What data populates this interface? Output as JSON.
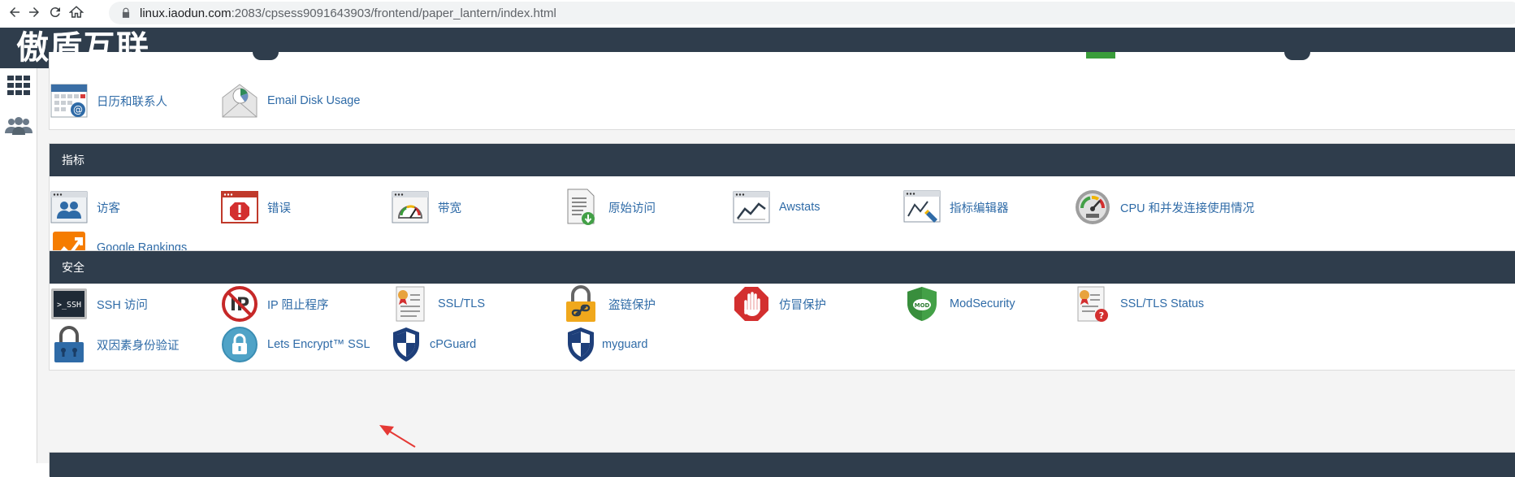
{
  "browser": {
    "url_host": "linux.iaodun.com",
    "url_rest": ":2083/cpsess9091643903/frontend/paper_lantern/index.html"
  },
  "header": {
    "brand": "傲盾互联"
  },
  "email_section": {
    "items": [
      {
        "label": "日历和联系人",
        "icon": "calendar-contacts-icon"
      },
      {
        "label": "Email Disk Usage",
        "icon": "email-disk-usage-icon"
      }
    ]
  },
  "metrics": {
    "title": "指标",
    "items": [
      {
        "label": "访客",
        "icon": "visitors-icon"
      },
      {
        "label": "错误",
        "icon": "errors-icon"
      },
      {
        "label": "带宽",
        "icon": "bandwidth-icon"
      },
      {
        "label": "原始访问",
        "icon": "raw-access-icon"
      },
      {
        "label": "Awstats",
        "icon": "awstats-icon"
      },
      {
        "label": "指标编辑器",
        "icon": "metrics-editor-icon"
      },
      {
        "label": "CPU 和并发连接使用情况",
        "icon": "cpu-usage-icon"
      },
      {
        "label": "Google Rankings",
        "icon": "google-rankings-icon"
      }
    ]
  },
  "security": {
    "title": "安全",
    "items": [
      {
        "label": "SSH 访问",
        "icon": "ssh-icon"
      },
      {
        "label": "IP 阻止程序",
        "icon": "ip-blocker-icon"
      },
      {
        "label": "SSL/TLS",
        "icon": "ssl-tls-icon"
      },
      {
        "label": "盗链保护",
        "icon": "hotlink-protection-icon"
      },
      {
        "label": "仿冒保护",
        "icon": "leech-protection-icon"
      },
      {
        "label": "ModSecurity",
        "icon": "modsecurity-icon"
      },
      {
        "label": "SSL/TLS Status",
        "icon": "ssl-tls-status-icon"
      },
      {
        "label": "双因素身份验证",
        "icon": "two-factor-auth-icon"
      },
      {
        "label": "Lets Encrypt™ SSL",
        "icon": "lets-encrypt-icon"
      },
      {
        "label": "cPGuard",
        "icon": "cpguard-icon"
      },
      {
        "label": "myguard",
        "icon": "myguard-icon"
      }
    ]
  },
  "sidebar": {
    "icons": [
      {
        "icon": "apps-grid-icon"
      },
      {
        "icon": "users-icon"
      }
    ]
  },
  "colors": {
    "header": "#2f3d4c",
    "link": "#2f6ba7",
    "annotation_arrow": "#e53935"
  }
}
